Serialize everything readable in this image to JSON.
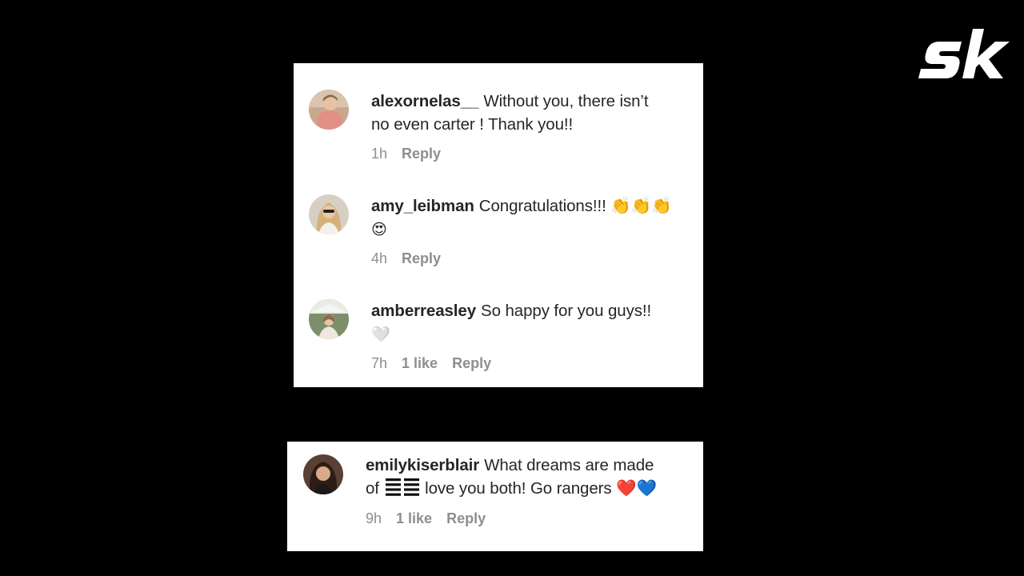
{
  "brand": {
    "logo_text": "sk",
    "logo_color": "#ffffff",
    "background_color": "#000000"
  },
  "comments_top": [
    {
      "username": "alexornelas__",
      "text_line1": "Without you, there isn’t",
      "text_line2": "no even carter ! Thank you!!",
      "time": "1h",
      "reply": "Reply",
      "avatar_icon": "child-avatar"
    },
    {
      "username": "amy_leibman",
      "text_line1": "Congratulations!!! 👏👏👏",
      "text_line2": "😍",
      "time": "4h",
      "reply": "Reply",
      "avatar_icon": "woman-avatar"
    },
    {
      "username": "amberreasley",
      "text_line1": "So happy for you guys!!",
      "text_line2": "🤍",
      "time": "7h",
      "likes": "1 like",
      "reply": "Reply",
      "avatar_icon": "woman-outdoor-avatar"
    }
  ],
  "comment_bottom": {
    "username": "emilykiserblair",
    "text_line1": "What dreams are made",
    "text_line2_prefix": "of",
    "text_line2_suffix": "love you both! Go rangers ❤️💙",
    "flag_icon": "usa-flag-emoji",
    "time": "9h",
    "likes": "1 like",
    "reply": "Reply",
    "avatar_icon": "woman-dark-hair-avatar"
  }
}
